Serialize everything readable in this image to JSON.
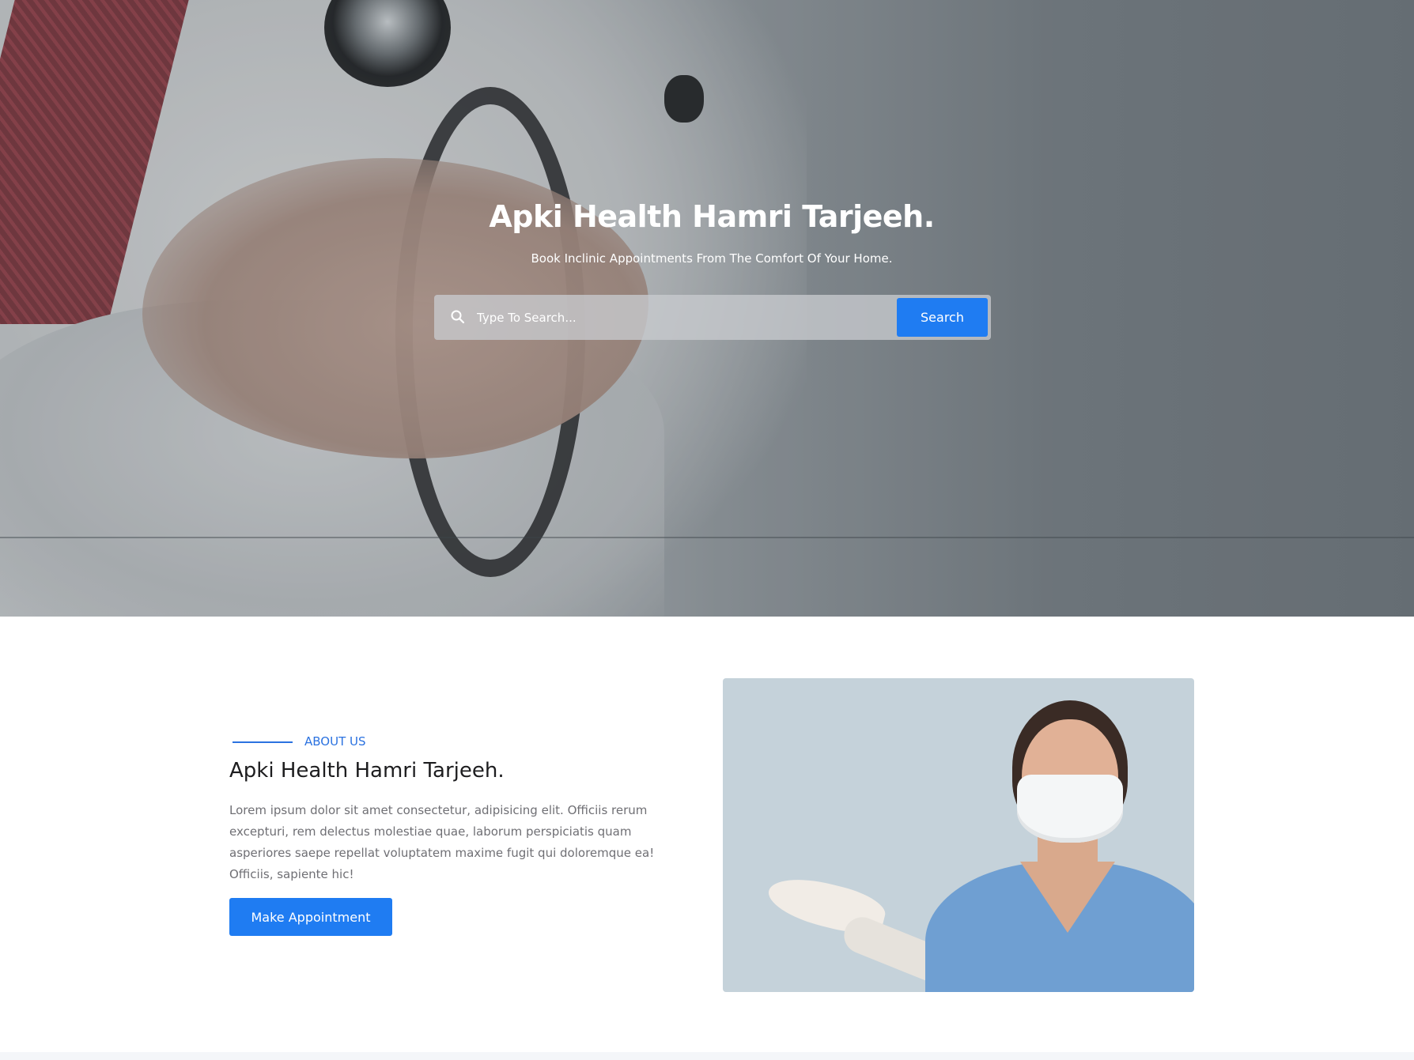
{
  "hero": {
    "title": "Apki Health Hamri Tarjeeh.",
    "subtitle": "Book Inclinic Appointments From The Comfort Of Your Home.",
    "search": {
      "placeholder": "Type To Search...",
      "value": "",
      "button_label": "Search",
      "icon": "search-icon"
    }
  },
  "about": {
    "label": "ABOUT US",
    "title": "Apki Health Hamri Tarjeeh.",
    "body": "Lorem ipsum dolor sit amet consectetur, adipisicing elit. Officiis rerum excepturi, rem delectus molestiae quae, laborum perspiciatis quam asperiores saepe repellat voluptatem maxime fugit qui doloremque ea! Officiis, sapiente hic!",
    "button_label": "Make Appointment"
  },
  "colors": {
    "accent": "#1f7cf2",
    "label": "#2b72e0",
    "heading": "#1d1d1f",
    "body_text": "#6f6f74"
  }
}
